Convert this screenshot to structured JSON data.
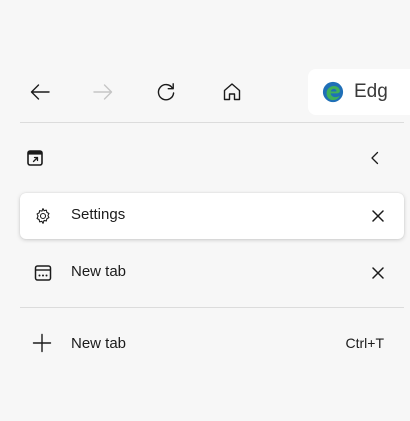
{
  "toolbar": {
    "back_icon": "arrow-left-icon",
    "forward_icon": "arrow-right-icon",
    "refresh_icon": "refresh-icon",
    "home_icon": "home-icon",
    "address_text": "Edg"
  },
  "vertical_tabs": {
    "header": {
      "actions_icon": "tab-actions-icon",
      "collapse_icon": "chevron-left-icon"
    },
    "tabs": [
      {
        "label": "Settings",
        "icon": "settings-gear-icon",
        "active": true
      },
      {
        "label": "New tab",
        "icon": "new-tab-page-icon",
        "active": false
      }
    ],
    "new_tab": {
      "label": "New tab",
      "shortcut": "Ctrl+T"
    }
  },
  "colors": {
    "background": "#f7f7f7",
    "active_tab": "#ffffff",
    "separator": "#dcdcdc",
    "disabled_icon": "#c5c5c5",
    "edge_blue": "#1f6fb7",
    "edge_green": "#3fb05a"
  }
}
